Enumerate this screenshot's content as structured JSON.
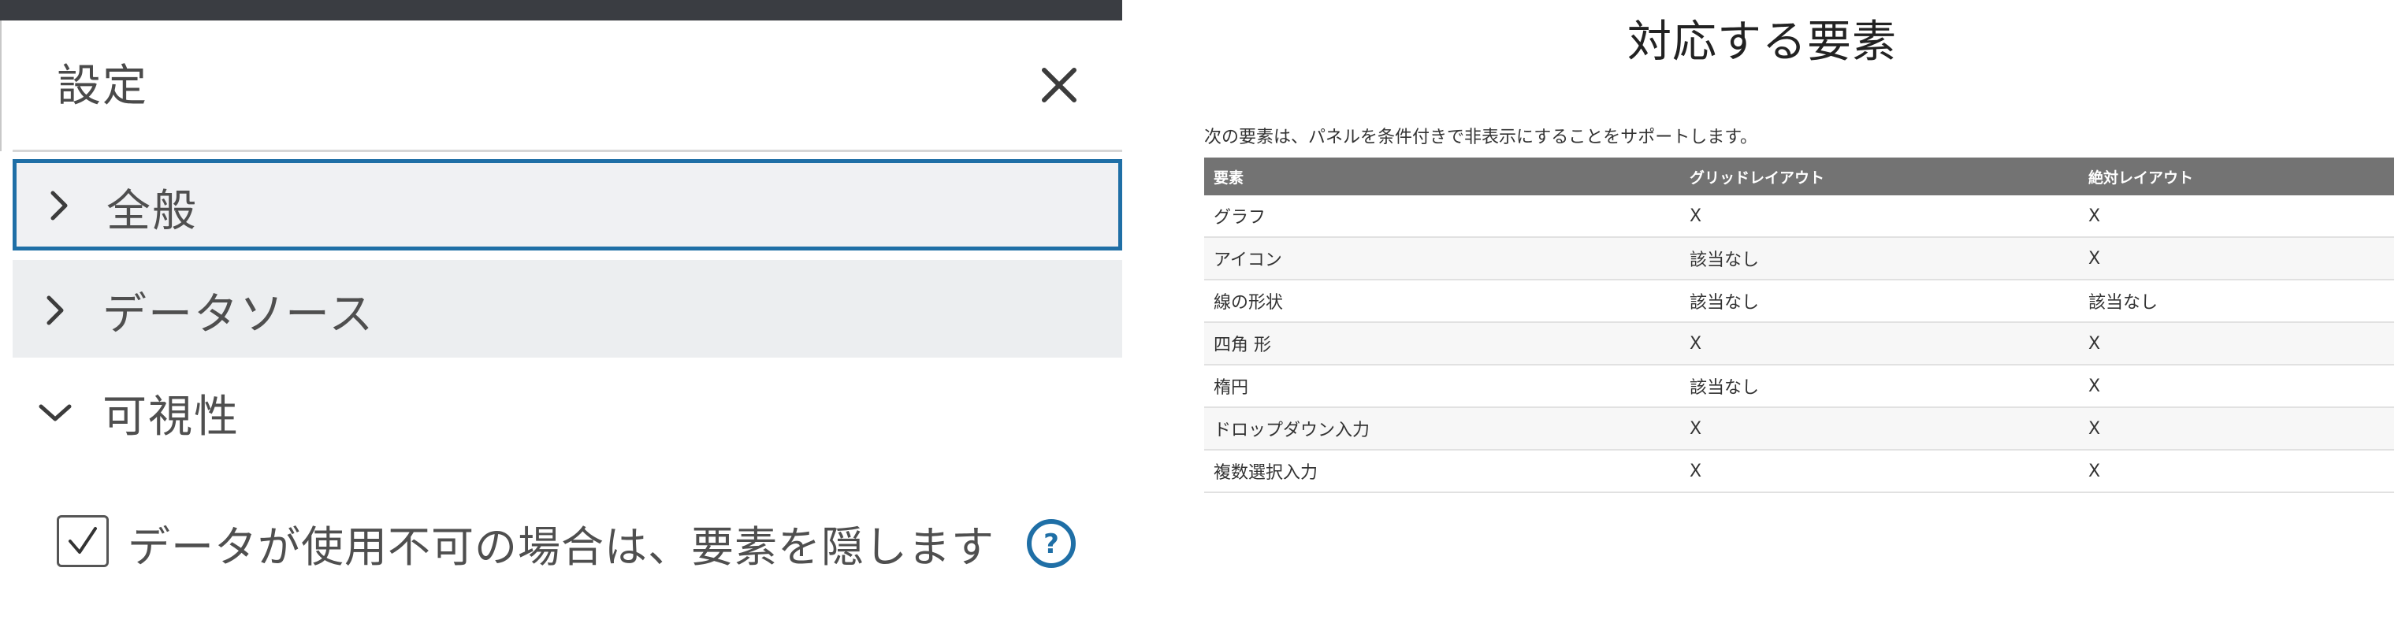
{
  "panel": {
    "title": "設定",
    "sections": {
      "general": "全般",
      "datasource": "データソース",
      "visibility": "可視性"
    },
    "checkbox": {
      "label": "データが使用不可の場合は、要素を隠します",
      "checked": true
    },
    "icons": {
      "close": "close-icon",
      "collapsed": "chevron-right-icon",
      "expanded": "chevron-down-icon",
      "help": "help-circle-icon"
    },
    "colors": {
      "focus": "#1f6fa6",
      "topbar": "#3a3d42",
      "help": "#1f6fa6"
    }
  },
  "doc": {
    "title": "対応する要素",
    "description": "次の要素は、パネルを条件付きで非表示にすることをサポートします。",
    "table": {
      "headers": [
        "要素",
        "グリッドレイアウト",
        "絶対レイアウト"
      ],
      "rows": [
        [
          "グラフ",
          "X",
          "X"
        ],
        [
          "アイコン",
          "該当なし",
          "X"
        ],
        [
          "線の形状",
          "該当なし",
          "該当なし"
        ],
        [
          "四角 形",
          "X",
          "X"
        ],
        [
          "楕円",
          "該当なし",
          "X"
        ],
        [
          "ドロップダウン入力",
          "X",
          "X"
        ],
        [
          "複数選択入力",
          "X",
          "X"
        ]
      ],
      "header_color": "#737373"
    }
  }
}
